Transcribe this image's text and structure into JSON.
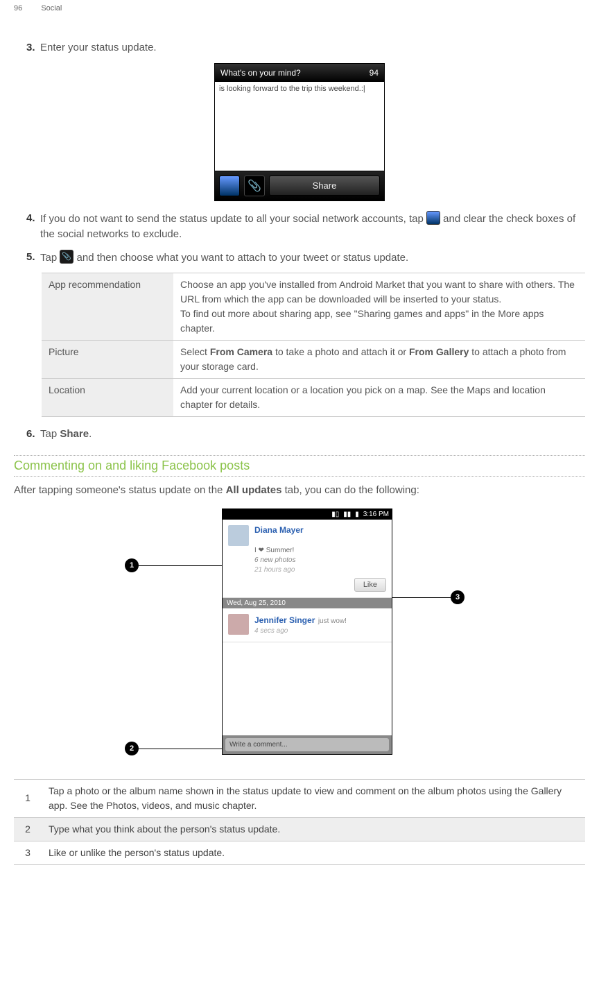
{
  "header": {
    "page_number": "96",
    "section": "Social"
  },
  "steps": {
    "s3": {
      "num": "3.",
      "text": "Enter your status update."
    },
    "s4": {
      "num": "4.",
      "pre": "If you do not want to send the status update to all your social network accounts, tap ",
      "post": " and clear the check boxes of the social networks to exclude."
    },
    "s5": {
      "num": "5.",
      "pre": "Tap ",
      "post": " and then choose what you want to attach to your tweet or status update."
    },
    "s6": {
      "num": "6.",
      "pre": "Tap ",
      "bold": "Share",
      "post": "."
    }
  },
  "sshot1": {
    "prompt": "What's on your mind?",
    "count": "94",
    "typed": "is looking forward to the trip this weekend.:|",
    "share": "Share"
  },
  "attach_table": {
    "r1": {
      "label": "App recommendation",
      "text": "Choose an app you've installed from Android Market that you want to share with others. The URL from which the app can be downloaded will be inserted to your status.\nTo find out more about sharing app, see \"Sharing games and apps\" in the More apps chapter."
    },
    "r2": {
      "label": "Picture",
      "pre": "Select ",
      "b1": "From Camera",
      "mid": " to take a photo and attach it or ",
      "b2": "From Gallery",
      "post": " to attach a photo from your storage card."
    },
    "r3": {
      "label": "Location",
      "text": "Add your current location or a location you pick on a map. See the Maps and location chapter for details."
    }
  },
  "section2": {
    "title": "Commenting on and liking Facebook posts",
    "intro_pre": "After tapping someone's status update on the ",
    "intro_bold": "All updates",
    "intro_post": " tab, you can do the following:"
  },
  "sshot2": {
    "time": "3:16 PM",
    "name1": "Diana Mayer",
    "line1a": "I ❤ Summer!",
    "line1b": "6 new photos",
    "line1c": "21 hours ago",
    "like": "Like",
    "datehdr": "Wed, Aug 25, 2010",
    "name2": "Jennifer Singer",
    "text2": "just wow!",
    "time2": "4 secs ago",
    "comment_ph": "Write a comment..."
  },
  "callouts": {
    "c1": "1",
    "c2": "2",
    "c3": "3"
  },
  "legend": {
    "r1": {
      "n": "1",
      "t": "Tap a photo or the album name shown in the status update to view and comment on the album photos using the Gallery app. See the Photos, videos, and music chapter."
    },
    "r2": {
      "n": "2",
      "t": "Type what you think about the person's status update."
    },
    "r3": {
      "n": "3",
      "t": "Like or unlike the person's status update."
    }
  }
}
